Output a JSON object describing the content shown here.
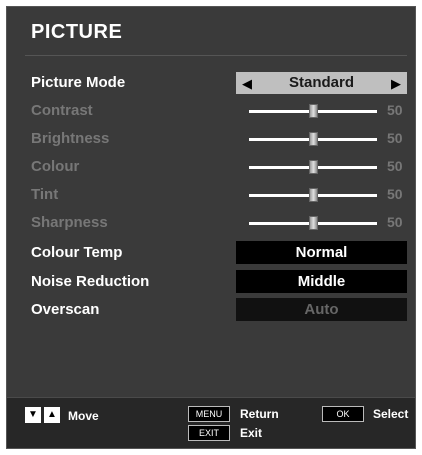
{
  "menu": {
    "title": "PICTURE",
    "picture_mode": {
      "label": "Picture Mode",
      "value": "Standard",
      "left_arrow": "◀",
      "right_arrow": "▶"
    },
    "sliders": [
      {
        "label": "Contrast",
        "value": "50"
      },
      {
        "label": "Brightness",
        "value": "50"
      },
      {
        "label": "Colour",
        "value": "50"
      },
      {
        "label": "Tint",
        "value": "50"
      },
      {
        "label": "Sharpness",
        "value": "50"
      }
    ],
    "colour_temp": {
      "label": "Colour Temp",
      "value": "Normal"
    },
    "noise_reduction": {
      "label": "Noise Reduction",
      "value": "Middle"
    },
    "overscan": {
      "label": "Overscan",
      "value": "Auto"
    }
  },
  "footer": {
    "move_label": "Move",
    "menu_key": "MENU",
    "return_label": "Return",
    "ok_key": "OK",
    "select_label": "Select",
    "exit_key": "EXIT",
    "exit_label": "Exit",
    "down_icon": "▼",
    "up_icon": "▲"
  }
}
